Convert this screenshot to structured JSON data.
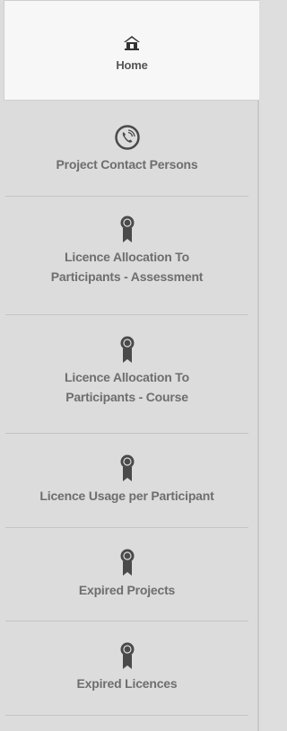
{
  "nav": {
    "items": [
      {
        "label": "Home",
        "icon": "home-icon",
        "active": true
      },
      {
        "label": "Project Contact Persons",
        "icon": "phone-icon",
        "active": false
      },
      {
        "label_lines": [
          "Licence Allocation To",
          "Participants - Assessment"
        ],
        "icon": "award-ribbon-icon",
        "active": false
      },
      {
        "label_lines": [
          "Licence Allocation To",
          "Participants - Course"
        ],
        "icon": "award-ribbon-icon",
        "active": false
      },
      {
        "label": "Licence Usage per Participant",
        "icon": "award-ribbon-icon",
        "active": false
      },
      {
        "label": "Expired Projects",
        "icon": "award-ribbon-icon",
        "active": false
      },
      {
        "label": "Expired Licences",
        "icon": "award-ribbon-icon",
        "active": false
      }
    ]
  },
  "colors": {
    "sidebar_bg": "#dcdcdc",
    "active_bg": "#f7f7f7",
    "icon": "#4a4a4a",
    "label": "#6e6e6e",
    "divider": "#c4c4c4"
  }
}
